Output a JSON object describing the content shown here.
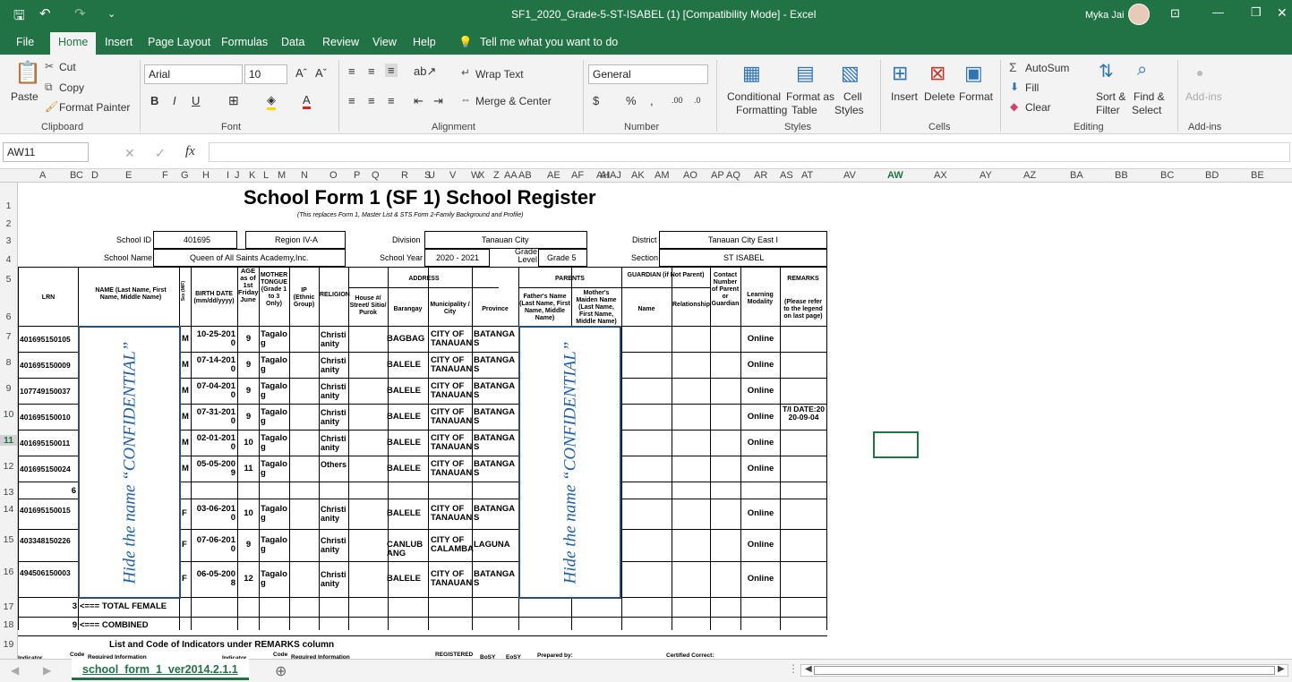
{
  "titlebar": {
    "title": "SF1_2020_Grade-5-ST-ISABEL (1)  [Compatibility Mode]  -  Excel",
    "user": "Myka Jai"
  },
  "tabs": [
    "File",
    "Home",
    "Insert",
    "Page Layout",
    "Formulas",
    "Data",
    "Review",
    "View",
    "Help"
  ],
  "tell_me": "Tell me what you want to do",
  "ribbon": {
    "paste": "Paste",
    "cut": "Cut",
    "copy": "Copy",
    "format_painter": "Format Painter",
    "clipboard": "Clipboard",
    "font_name": "Arial",
    "font_size": "10",
    "font": "Font",
    "wrap_text": "Wrap Text",
    "merge_center": "Merge & Center",
    "alignment": "Alignment",
    "number_format": "General",
    "number": "Number",
    "conditional": "Conditional",
    "formatting": "Formatting",
    "format_as": "Format as",
    "table": "Table",
    "cell": "Cell",
    "styles_btn": "Styles",
    "styles": "Styles",
    "insert": "Insert",
    "delete": "Delete",
    "format": "Format",
    "cells": "Cells",
    "autosum": "AutoSum",
    "fill": "Fill",
    "clear": "Clear",
    "sort": "Sort &",
    "filter": "Filter",
    "find": "Find &",
    "select": "Select",
    "editing": "Editing",
    "addins": "Add-ins",
    "addins_group": "Add-ins"
  },
  "formula_bar": {
    "name_box": "AW11",
    "fx": "fx"
  },
  "columns": [
    "A",
    "B",
    "C",
    "D",
    "E",
    "F",
    "G",
    "H",
    "I",
    "J",
    "K",
    "L",
    "M",
    "N",
    "O",
    "P",
    "Q",
    "R",
    "S",
    "T",
    "U",
    "V",
    "W",
    "X",
    "Y",
    "Z",
    "AA",
    "AB",
    "AC",
    "AD",
    "AE",
    "AF",
    "AG",
    "AH",
    "AI",
    "AJ",
    "AK",
    "AL",
    "AM",
    "AN",
    "AO",
    "AP",
    "AQ",
    "AR",
    "AS",
    "AT",
    "AV",
    "AW",
    "AX",
    "AY",
    "AZ",
    "BA",
    "BB",
    "BC",
    "BD",
    "BE"
  ],
  "rows": [
    "1",
    "2",
    "3",
    "4",
    "5",
    "6",
    "7",
    "8",
    "9",
    "10",
    "11",
    "12",
    "13",
    "14",
    "15",
    "16",
    "17",
    "18",
    "19"
  ],
  "form": {
    "title": "School Form 1 (SF 1) School Register",
    "subtitle": "(This replaces Form 1, Master List & STS Form 2-Family Background and Profile)",
    "school_id_label": "School ID",
    "school_id": "401695",
    "region": "Region IV-A",
    "division_label": "Division",
    "division": "Tanauan City",
    "district_label": "District",
    "district": "Tanauan City East I",
    "school_name_label": "School Name",
    "school_name": "Queen of All Saints Academy,Inc.",
    "school_year_label": "School Year",
    "school_year": "2020 - 2021",
    "grade_level_label": "Grade Level",
    "grade_level": "Grade 5",
    "section_label": "Section",
    "section": "ST ISABEL",
    "h_lrn": "LRN",
    "h_name": "NAME (Last Name, First Name, Middle Name)",
    "h_sex": "Sex (M/F)",
    "h_birth": "BIRTH DATE (mm/dd/yyyy)",
    "h_age": "AGE as of 1st Friday June",
    "h_mother_tongue": "MOTHER TONGUE (Grade 1 to 3 Only)",
    "h_ip": "IP (Ethnic Group)",
    "h_religion": "RELIGION",
    "h_address": "ADDRESS",
    "h_house": "House #/ Street/ Sitio/ Purok",
    "h_barangay": "Barangay",
    "h_municipality": "Municipality / City",
    "h_province": "Province",
    "h_parents": "PARENTS",
    "h_father": "Father's Name (Last Name, First Name, Middle Name)",
    "h_mother": "Mother's Maiden Name (Last Name, First Name, Middle Name)",
    "h_guardian": "GUARDIAN (if Not Parent)",
    "h_g_name": "Name",
    "h_relationship": "Relationship",
    "h_contact": "Contact Number of Parent or Guardian",
    "h_modality": "Learning Modality",
    "h_remarks": "REMARKS",
    "h_remarks_note": "(Please refer to the legend on last page)",
    "confidential": "Hide the name “CONFIDENTIAL”",
    "total_female_count": "3",
    "total_female": "<=== TOTAL FEMALE",
    "combined_count": "9",
    "combined": "<=== COMBINED",
    "indicators_title": "List and Code of Indicators under REMARKS column",
    "f_indicator": "Indicator",
    "f_code": "Code",
    "f_required": "Required Information",
    "f_indicator2": "Indicator",
    "f_code2": "Code",
    "f_required2": "Required Information",
    "f_registered": "REGISTERED",
    "f_boy": "BoSY",
    "f_eosy": "EoSY",
    "f_prepared": "Prepared by:",
    "f_certified": "Certified Correct:",
    "male_count": "6"
  },
  "students": [
    {
      "lrn": "401695150105",
      "sex": "M",
      "birth": "10-25-2010",
      "age": "9",
      "tongue": "Tagalog",
      "religion": "Christianity",
      "barangay": "BAGBAG",
      "city": "CITY OF TANAUAN",
      "province": "BATANGAS",
      "modality": "Online",
      "remarks": ""
    },
    {
      "lrn": "401695150009",
      "sex": "M",
      "birth": "07-14-2010",
      "age": "9",
      "tongue": "Tagalog",
      "religion": "Christianity",
      "barangay": "BALELE",
      "city": "CITY OF TANAUAN",
      "province": "BATANGAS",
      "modality": "Online",
      "remarks": ""
    },
    {
      "lrn": "107749150037",
      "sex": "M",
      "birth": "07-04-2010",
      "age": "9",
      "tongue": "Tagalog",
      "religion": "Christianity",
      "barangay": "BALELE",
      "city": "CITY OF TANAUAN",
      "province": "BATANGAS",
      "modality": "Online",
      "remarks": ""
    },
    {
      "lrn": "401695150010",
      "sex": "M",
      "birth": "07-31-2010",
      "age": "9",
      "tongue": "Tagalog",
      "religion": "Christianity",
      "barangay": "BALELE",
      "city": "CITY OF TANAUAN",
      "province": "BATANGAS",
      "modality": "Online",
      "remarks": "T/I DATE:2020-09-04"
    },
    {
      "lrn": "401695150011",
      "sex": "M",
      "birth": "02-01-2010",
      "age": "10",
      "tongue": "Tagalog",
      "religion": "Christianity",
      "barangay": "BALELE",
      "city": "CITY OF TANAUAN",
      "province": "BATANGAS",
      "modality": "Online",
      "remarks": ""
    },
    {
      "lrn": "401695150024",
      "sex": "M",
      "birth": "05-05-2009",
      "age": "11",
      "tongue": "Tagalog",
      "religion": "Others",
      "barangay": "BALELE",
      "city": "CITY OF TANAUAN",
      "province": "BATANGAS",
      "modality": "Online",
      "remarks": ""
    },
    {
      "lrn": "401695150015",
      "sex": "F",
      "birth": "03-06-2010",
      "age": "10",
      "tongue": "Tagalog",
      "religion": "Christianity",
      "barangay": "BALELE",
      "city": "CITY OF TANAUAN",
      "province": "BATANGAS",
      "modality": "Online",
      "remarks": ""
    },
    {
      "lrn": "403348150226",
      "sex": "F",
      "birth": "07-06-2010",
      "age": "9",
      "tongue": "Tagalog",
      "religion": "Christianity",
      "barangay": "CANLUBANG",
      "city": "CITY OF CALAMBA",
      "province": "LAGUNA",
      "modality": "Online",
      "remarks": ""
    },
    {
      "lrn": "494506150003",
      "sex": "F",
      "birth": "06-05-2008",
      "age": "12",
      "tongue": "Tagalog",
      "religion": "Christianity",
      "barangay": "BALELE",
      "city": "CITY OF TANAUAN",
      "province": "BATANGAS",
      "modality": "Online",
      "remarks": ""
    }
  ],
  "sheet_tab": "school_form_1_ver2014.2.1.1"
}
